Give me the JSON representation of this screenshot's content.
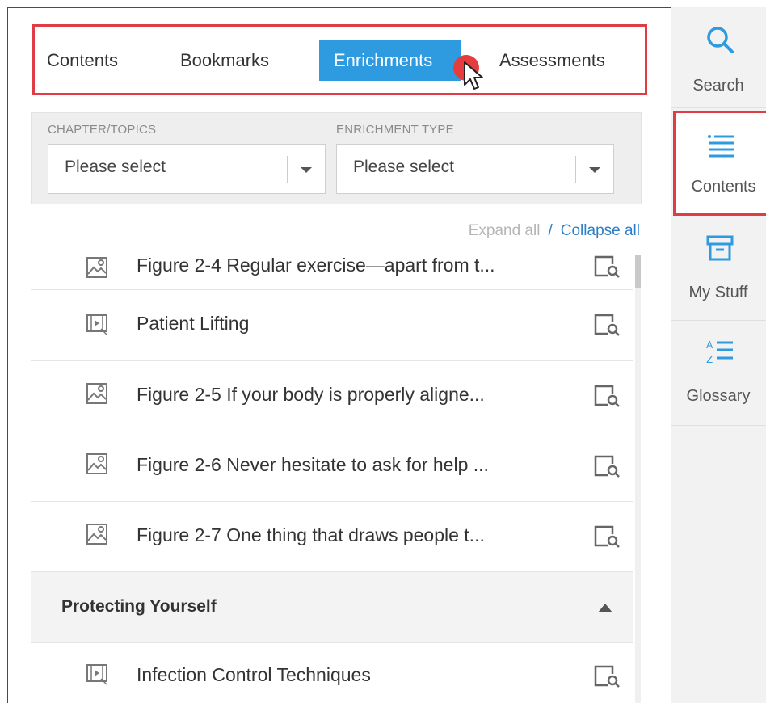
{
  "tabs": [
    {
      "label": "Contents",
      "active": false
    },
    {
      "label": "Bookmarks",
      "active": false
    },
    {
      "label": "Enrichments",
      "active": true
    },
    {
      "label": "Assessments",
      "active": false
    }
  ],
  "filters": {
    "chapter": {
      "label": "CHAPTER/TOPICS",
      "value": "Please select"
    },
    "type": {
      "label": "ENRICHMENT TYPE",
      "value": "Please select"
    }
  },
  "controls": {
    "expand_all": "Expand all",
    "separator": "/",
    "collapse_all": "Collapse all"
  },
  "items": [
    {
      "title": "Figure 2-4 Regular exercise—apart from t...",
      "icon": "image-icon"
    },
    {
      "title": "Patient Lifting",
      "icon": "video-icon"
    },
    {
      "title": "Figure 2-5 If your body is properly aligne...",
      "icon": "image-icon"
    },
    {
      "title": "Figure 2-6 Never hesitate to ask for help ...",
      "icon": "image-icon"
    },
    {
      "title": "Figure 2-7 One thing that draws people t...",
      "icon": "image-icon"
    }
  ],
  "section": {
    "title": "Protecting Yourself",
    "expanded": true
  },
  "section_items": [
    {
      "title": "Infection Control Techniques",
      "icon": "video-icon"
    }
  ],
  "sidebar": {
    "items": [
      {
        "label": "Search",
        "icon": "search-icon"
      },
      {
        "label": "Contents",
        "icon": "list-icon",
        "active": true
      },
      {
        "label": "My Stuff",
        "icon": "archive-box-icon"
      },
      {
        "label": "Glossary",
        "icon": "a-z-sort-icon"
      }
    ]
  },
  "colors": {
    "accent": "#2e9be0",
    "highlight": "#e03c45",
    "link": "#2e7ec7",
    "sidebar_icon": "#2e9be0"
  }
}
